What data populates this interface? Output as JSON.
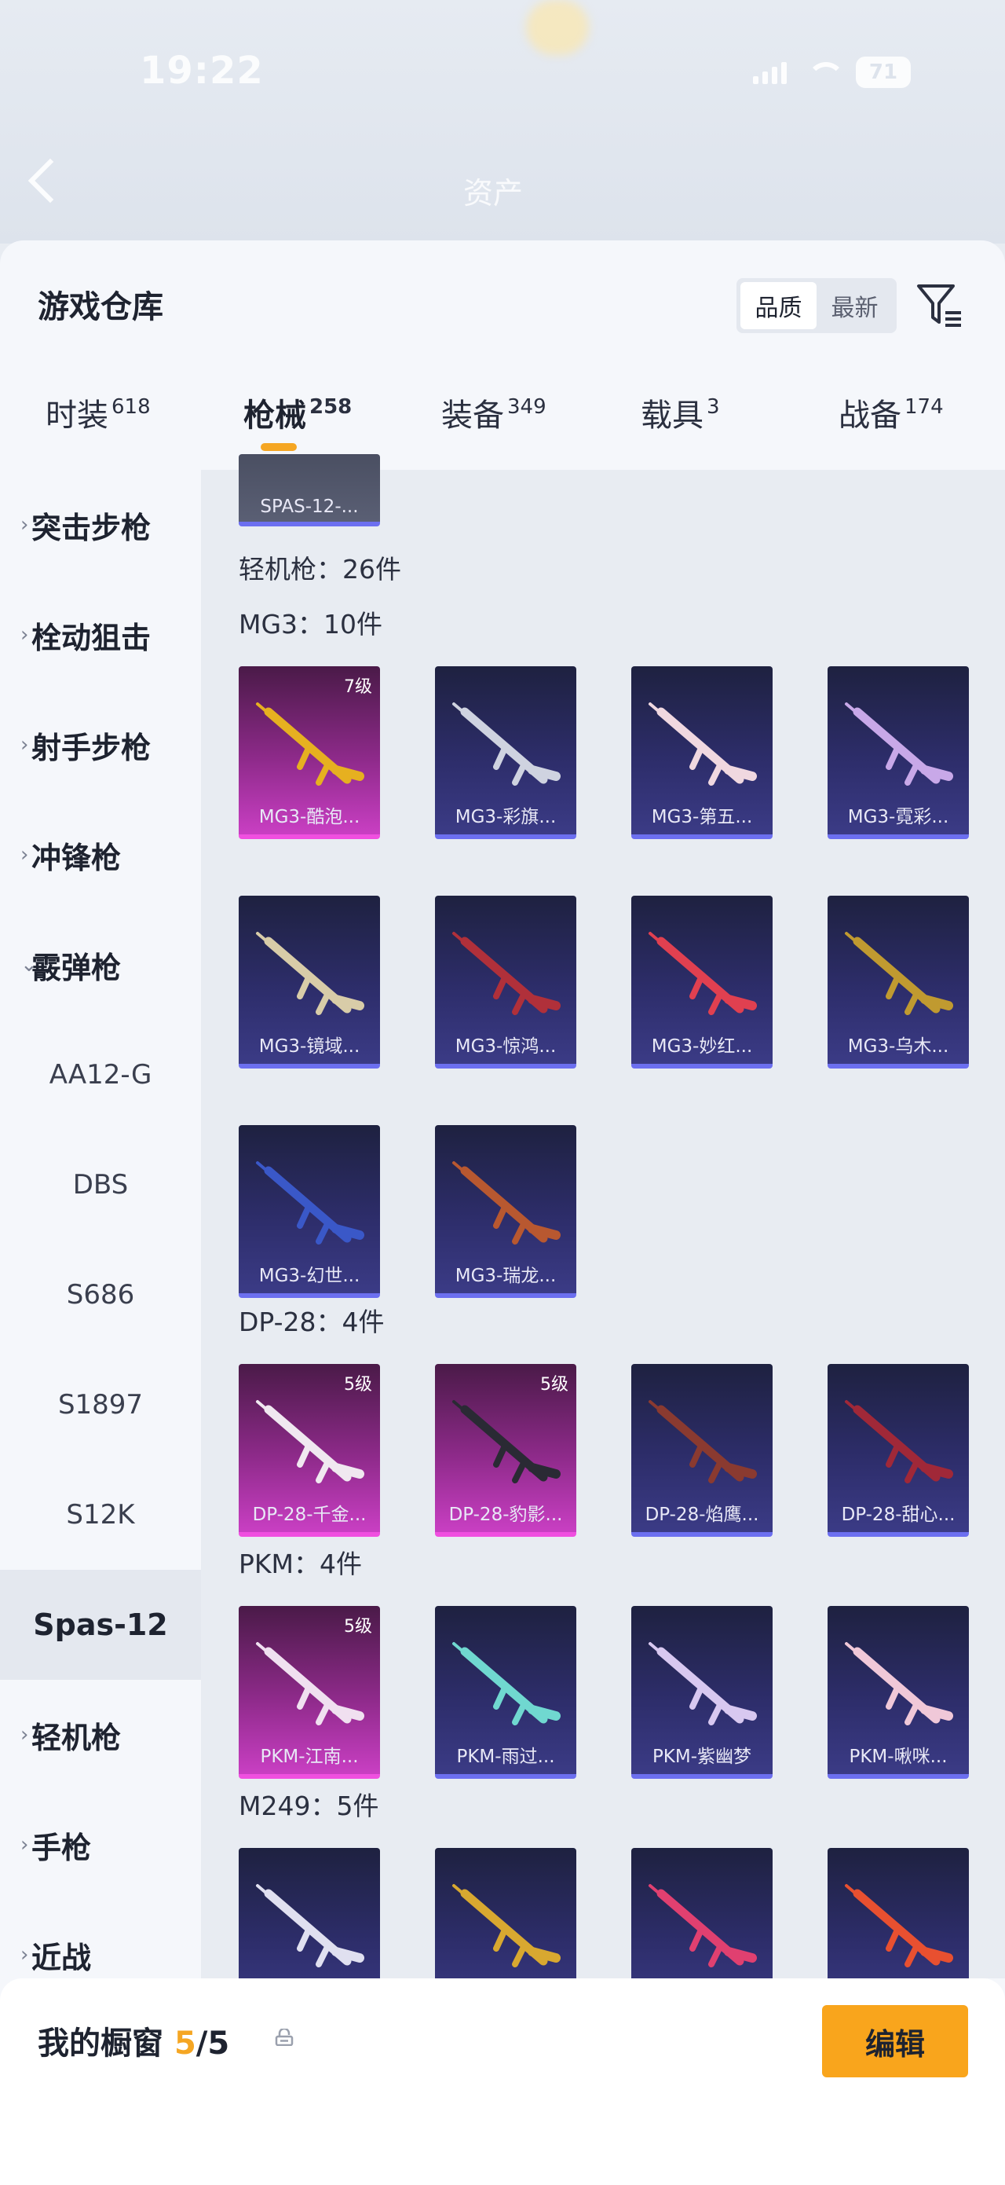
{
  "status_bar": {
    "time": "19:22",
    "battery": "71"
  },
  "header": {
    "assets_label": "资产"
  },
  "sheet": {
    "title": "游戏仓库",
    "sort": {
      "options": [
        "品质",
        "最新"
      ],
      "selected": "品质"
    },
    "filter_icon": "filter-icon",
    "tabs": [
      {
        "label": "时装",
        "count": "618"
      },
      {
        "label": "枪械",
        "count": "258",
        "active": true
      },
      {
        "label": "装备",
        "count": "349"
      },
      {
        "label": "载具",
        "count": "3"
      },
      {
        "label": "战备",
        "count": "174"
      }
    ]
  },
  "sidebar": {
    "categories": [
      {
        "label": "突击步枪",
        "expanded": false
      },
      {
        "label": "栓动狙击",
        "expanded": false
      },
      {
        "label": "射手步枪",
        "expanded": false
      },
      {
        "label": "冲锋枪",
        "expanded": false
      },
      {
        "label": "霰弹枪",
        "expanded": true
      }
    ],
    "subitems": [
      {
        "label": "AA12-G"
      },
      {
        "label": "DBS"
      },
      {
        "label": "S686"
      },
      {
        "label": "S1897"
      },
      {
        "label": "S12K"
      },
      {
        "label": "Spas-12",
        "selected": true
      }
    ],
    "more_categories": [
      {
        "label": "轻机枪"
      },
      {
        "label": "手枪"
      },
      {
        "label": "近战"
      }
    ]
  },
  "content": {
    "top_card": {
      "name": "SPAS-12-..."
    },
    "section_label": "轻机枪：26件",
    "groups": [
      {
        "label": "MG3：10件",
        "items": [
          {
            "name": "MG3-酷泡...",
            "rarity": "pink",
            "level": "7级",
            "gun_color": "#e6b020"
          },
          {
            "name": "MG3-彩旗...",
            "rarity": "purple",
            "level": "",
            "gun_color": "#cfd3e0"
          },
          {
            "name": "MG3-第五...",
            "rarity": "purple",
            "level": "",
            "gun_color": "#f0d8e0"
          },
          {
            "name": "MG3-霓彩...",
            "rarity": "purple",
            "level": "",
            "gun_color": "#c8a8e8"
          },
          {
            "name": "MG3-镜域...",
            "rarity": "purple",
            "level": "",
            "gun_color": "#d8cca8"
          },
          {
            "name": "MG3-惊鸿...",
            "rarity": "purple",
            "level": "",
            "gun_color": "#b0303a"
          },
          {
            "name": "MG3-妙红...",
            "rarity": "purple",
            "level": "",
            "gun_color": "#e04050"
          },
          {
            "name": "MG3-乌木...",
            "rarity": "purple",
            "level": "",
            "gun_color": "#c09a30"
          },
          {
            "name": "MG3-幻世...",
            "rarity": "purple",
            "level": "",
            "gun_color": "#3a58c8"
          },
          {
            "name": "MG3-瑞龙...",
            "rarity": "purple",
            "level": "",
            "gun_color": "#b85830"
          }
        ]
      },
      {
        "label": "DP-28：4件",
        "items": [
          {
            "name": "DP-28-千金...",
            "rarity": "pink",
            "level": "5级",
            "gun_color": "#f0e8f0"
          },
          {
            "name": "DP-28-豹影...",
            "rarity": "pink",
            "level": "5级",
            "gun_color": "#2a2a34"
          },
          {
            "name": "DP-28-焰鹰...",
            "rarity": "purple",
            "level": "",
            "gun_color": "#8a3a30"
          },
          {
            "name": "DP-28-甜心...",
            "rarity": "purple",
            "level": "",
            "gun_color": "#a02838"
          }
        ]
      },
      {
        "label": "PKM：4件",
        "items": [
          {
            "name": "PKM-江南...",
            "rarity": "pink",
            "level": "5级",
            "gun_color": "#f0e0f0"
          },
          {
            "name": "PKM-雨过...",
            "rarity": "purple",
            "level": "",
            "gun_color": "#70d8d0"
          },
          {
            "name": "PKM-紫幽梦",
            "rarity": "purple",
            "level": "",
            "gun_color": "#d8c8f0"
          },
          {
            "name": "PKM-啾咪...",
            "rarity": "purple",
            "level": "",
            "gun_color": "#f0c8d8"
          }
        ]
      },
      {
        "label": "M249：5件",
        "items": [
          {
            "name": "",
            "rarity": "purple",
            "level": "",
            "gun_color": "#e0e0f0"
          },
          {
            "name": "",
            "rarity": "purple",
            "level": "",
            "gun_color": "#d8a830"
          },
          {
            "name": "",
            "rarity": "purple",
            "level": "",
            "gun_color": "#e04070"
          },
          {
            "name": "",
            "rarity": "purple",
            "level": "",
            "gun_color": "#e85030"
          }
        ]
      }
    ]
  },
  "fab_icon": "share-external-icon",
  "bottom_bar": {
    "label": "我的橱窗",
    "count_current": "5",
    "count_total": "/5",
    "lock_icon": "lock-icon",
    "edit_label": "编辑"
  },
  "colors": {
    "accent": "#f5a623",
    "purple_card": "#2d2d6a",
    "pink_card": "#c93fc3"
  }
}
